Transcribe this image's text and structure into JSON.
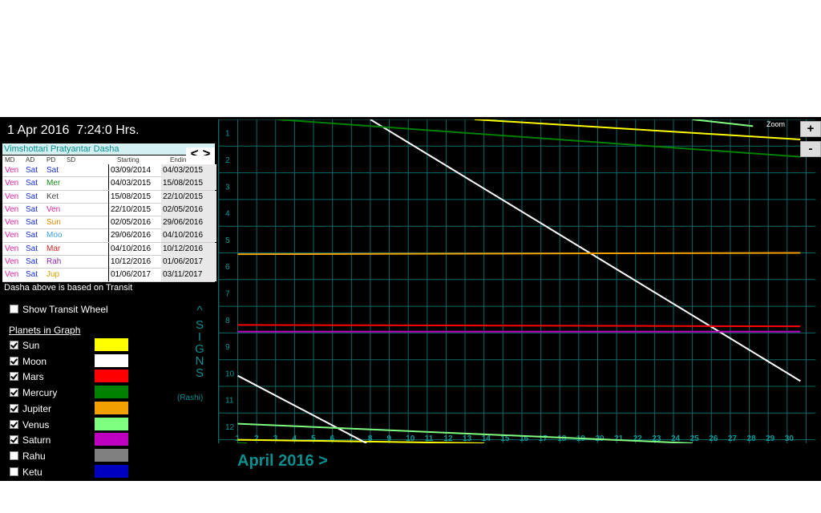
{
  "header": {
    "datetime": "1 Apr 2016  7:24:0 Hrs."
  },
  "dasha": {
    "title": "Vimshottari Pratyantar Dasha",
    "nav_prev": "<",
    "nav_next": ">",
    "columns": [
      "MD",
      "AD",
      "PD",
      "SD",
      "Starting",
      "Endin"
    ],
    "rows": [
      {
        "md": "Ven",
        "ad": "Sat",
        "pd": "Sat",
        "pd_color": "#1a2ed8",
        "start": "03/09/2014",
        "end": "04/03/2015"
      },
      {
        "md": "Ven",
        "ad": "Sat",
        "pd": "Mer",
        "pd_color": "#1a8a1a",
        "start": "04/03/2015",
        "end": "15/08/2015"
      },
      {
        "md": "Ven",
        "ad": "Sat",
        "pd": "Ket",
        "pd_color": "#444444",
        "start": "15/08/2015",
        "end": "22/10/2015"
      },
      {
        "md": "Ven",
        "ad": "Sat",
        "pd": "Ven",
        "pd_color": "#e0249a",
        "start": "22/10/2015",
        "end": "02/05/2016"
      },
      {
        "md": "Ven",
        "ad": "Sat",
        "pd": "Sun",
        "pd_color": "#e08a00",
        "start": "02/05/2016",
        "end": "29/06/2016"
      },
      {
        "md": "Ven",
        "ad": "Sat",
        "pd": "Moo",
        "pd_color": "#3aa0e0",
        "start": "29/06/2016",
        "end": "04/10/2016"
      },
      {
        "md": "Ven",
        "ad": "Sat",
        "pd": "Mar",
        "pd_color": "#d02020",
        "start": "04/10/2016",
        "end": "10/12/2016"
      },
      {
        "md": "Ven",
        "ad": "Sat",
        "pd": "Rah",
        "pd_color": "#8a2ab0",
        "start": "10/12/2016",
        "end": "01/06/2017"
      },
      {
        "md": "Ven",
        "ad": "Sat",
        "pd": "Jup",
        "pd_color": "#d8a000",
        "start": "01/06/2017",
        "end": "03/11/2017"
      }
    ],
    "md_color": "#e0249a",
    "ad_color": "#1a2ed8",
    "note": "Dasha above is based on Transit"
  },
  "controls": {
    "show_transit_wheel": "Show Transit Wheel",
    "show_transit_checked": false,
    "planets_heading": "Planets in Graph"
  },
  "planets": [
    {
      "name": "Sun",
      "checked": true,
      "color": "#ffff00"
    },
    {
      "name": "Moon",
      "checked": true,
      "color": "#ffffff"
    },
    {
      "name": "Mars",
      "checked": true,
      "color": "#ff0000"
    },
    {
      "name": "Mercury",
      "checked": true,
      "color": "#008000"
    },
    {
      "name": "Jupiter",
      "checked": true,
      "color": "#f0a000"
    },
    {
      "name": "Venus",
      "checked": true,
      "color": "#80ff80"
    },
    {
      "name": "Saturn",
      "checked": true,
      "color": "#c000c0"
    },
    {
      "name": "Rahu",
      "checked": false,
      "color": "#808080"
    },
    {
      "name": "Ketu",
      "checked": false,
      "color": "#0000c0"
    }
  ],
  "signs_axis": {
    "caret": "^",
    "letters": [
      "S",
      "I",
      "G",
      "N",
      "S"
    ],
    "sub": "(Rashi)"
  },
  "zoom": {
    "label": "Zoom",
    "plus": "+",
    "minus": "-"
  },
  "month_nav": "April 2016 >",
  "chart_data": {
    "type": "line",
    "x_days": [
      1,
      2,
      3,
      4,
      5,
      6,
      7,
      8,
      9,
      10,
      11,
      12,
      13,
      14,
      15,
      16,
      17,
      18,
      19,
      20,
      21,
      22,
      23,
      24,
      25,
      26,
      27,
      28,
      29,
      30
    ],
    "y_signs": [
      1,
      2,
      3,
      4,
      5,
      6,
      7,
      8,
      9,
      10,
      11,
      12
    ],
    "xlim": [
      1,
      30.7
    ],
    "ylim": [
      0.7,
      12.7
    ],
    "series": [
      {
        "name": "Sun",
        "color": "#ffff00",
        "segments": [
          [
            [
              1,
              12.5
            ],
            [
              14,
              12.8
            ]
          ],
          [
            [
              13.5,
              0.7
            ],
            [
              30.7,
              1.25
            ]
          ]
        ]
      },
      {
        "name": "Moon",
        "color": "#ffffff",
        "segments": [
          [
            [
              1,
              10.1
            ],
            [
              7.8,
              12.8
            ]
          ],
          [
            [
              8,
              0.7
            ],
            [
              30.7,
              10.3
            ]
          ]
        ]
      },
      {
        "name": "Mars",
        "color": "#ff0000",
        "segments": [
          [
            [
              1,
              8.2
            ],
            [
              30.7,
              8.25
            ]
          ]
        ]
      },
      {
        "name": "Mercury",
        "color": "#008000",
        "segments": [
          [
            [
              1,
              12.7
            ],
            [
              1.5,
              12.8
            ]
          ],
          [
            [
              3.1,
              0.7
            ],
            [
              30.7,
              1.9
            ]
          ]
        ]
      },
      {
        "name": "Jupiter",
        "color": "#f0a000",
        "segments": [
          [
            [
              1,
              5.55
            ],
            [
              30.7,
              5.5
            ]
          ]
        ]
      },
      {
        "name": "Venus",
        "color": "#80ff80",
        "segments": [
          [
            [
              1,
              11.9
            ],
            [
              25,
              12.8
            ]
          ],
          [
            [
              25,
              0.65
            ],
            [
              28.2,
              0.75
            ]
          ]
        ]
      },
      {
        "name": "Saturn",
        "color": "#c000c0",
        "segments": [
          [
            [
              1,
              8.45
            ],
            [
              30.7,
              8.45
            ]
          ]
        ]
      }
    ]
  }
}
